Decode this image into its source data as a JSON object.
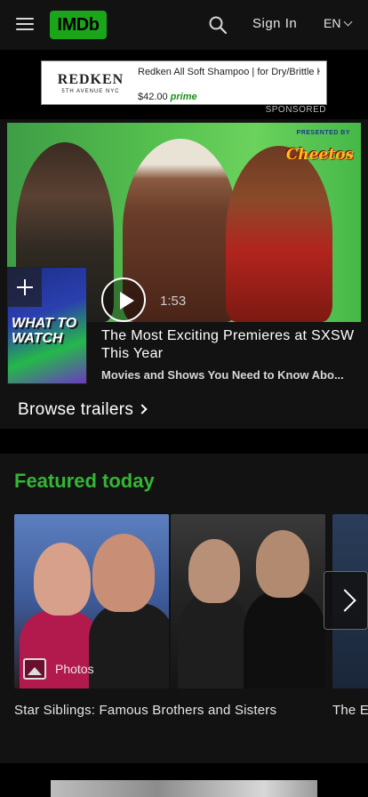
{
  "header": {
    "logo": "IMDb",
    "sign_in": "Sign In",
    "language": "EN"
  },
  "ad": {
    "brand": "REDKEN",
    "brand_sub": "5TH AVENUE NYC",
    "text": "Redken All Soft Shampoo | for Dry/Brittle Hair | Provides Intense...",
    "price": "$42.00",
    "prime": "prime",
    "sponsored_label": "SPONSORED"
  },
  "hero": {
    "presented_by": "PRESENTED BY",
    "sponsor_brand": "Cheetos",
    "poster_title": "WHAT TO WATCH",
    "duration": "1:53",
    "title": "The Most Exciting Premieres at SXSW This Year",
    "subtitle": "Movies and Shows You Need to Know Abo...",
    "browse_trailers": "Browse trailers"
  },
  "featured": {
    "heading": "Featured today",
    "photos_label": "Photos",
    "cards": [
      {
        "caption": "Star Siblings: Famous Brothers and Sisters"
      },
      {
        "caption": "The E"
      }
    ]
  },
  "colors": {
    "brand": "#1aa51a",
    "featured_heading": "#35b535",
    "background": "#000000",
    "surface": "#121212"
  }
}
